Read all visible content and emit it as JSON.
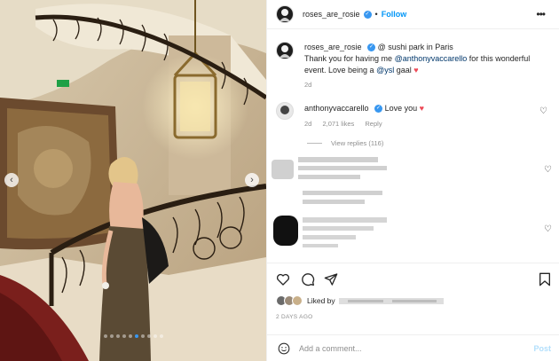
{
  "post": {
    "username": "roses_are_rosie",
    "follow_label": "Follow",
    "more_label": "•••"
  },
  "caption": {
    "username": "roses_are_rosie",
    "location_prefix": "@",
    "location": "sushi park in Paris",
    "line_part1": "Thank you for having me ",
    "mention1": "@anthonyvaccarello",
    "line_part2": " for this wonderful event. Love being a ",
    "mention2": "@ysl",
    "line_part3": " gaal",
    "heart": "♥",
    "time": "2d"
  },
  "comment": {
    "username": "anthonyvaccarello",
    "text": "Love you",
    "heart": "♥",
    "time": "2d",
    "likes": "2,071 likes",
    "reply_label": "Reply",
    "view_replies": "View replies (116)"
  },
  "likes": {
    "liked_by_label": "Liked by"
  },
  "date": "2 DAYS AGO",
  "comment_box": {
    "placeholder": "Add a comment...",
    "post_label": "Post"
  },
  "carousel": {
    "slide_count": 10,
    "active_index": 5
  },
  "colors": {
    "link": "#00376b",
    "accent": "#0095f6",
    "heart": "#ed4956",
    "verified": "#3897f0"
  }
}
